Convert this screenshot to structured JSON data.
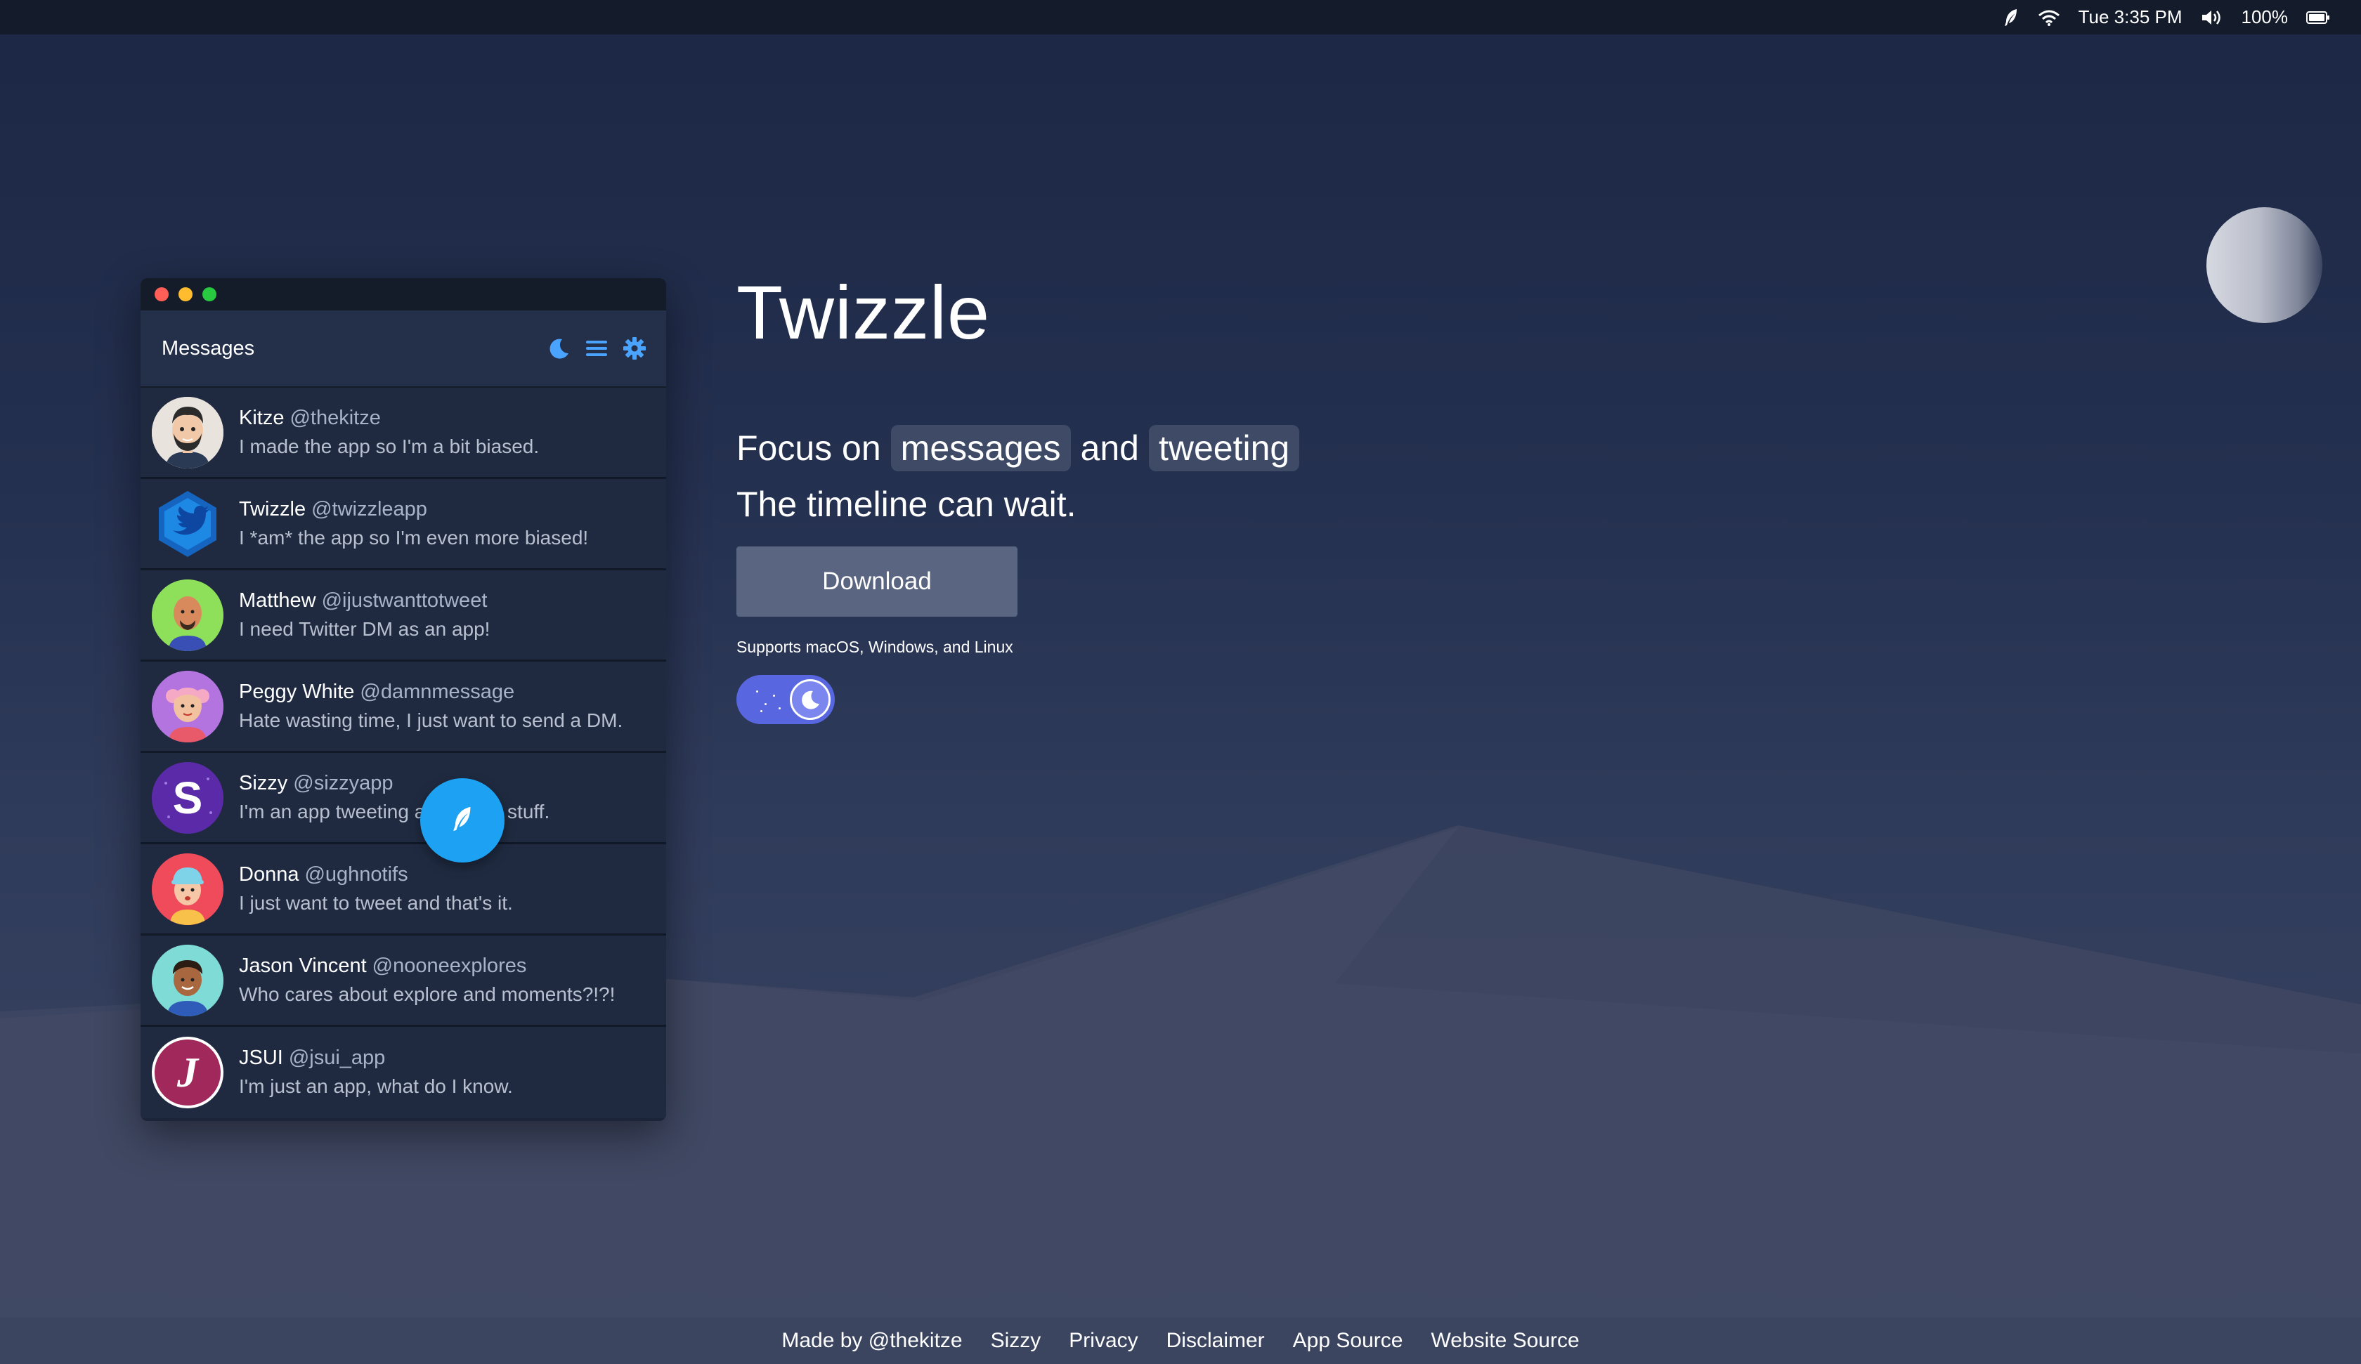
{
  "menubar": {
    "clock": "Tue 3:35 PM",
    "battery": "100%",
    "icons": [
      "feather-icon",
      "wifi-icon",
      "volume-icon",
      "battery-icon"
    ]
  },
  "app": {
    "header_title": "Messages",
    "header_icons": [
      "moon-icon",
      "menu-icon",
      "gear-icon"
    ],
    "accent": "#4aa3ff",
    "messages": [
      {
        "name": "Kitze",
        "handle": "@thekitze",
        "text": "I made the app so I'm a bit biased."
      },
      {
        "name": "Twizzle",
        "handle": "@twizzleapp",
        "text": "I *am* the app so I'm even more biased!"
      },
      {
        "name": "Matthew",
        "handle": "@ijustwanttotweet",
        "text": "I need Twitter DM as an app!"
      },
      {
        "name": "Peggy White",
        "handle": "@damnmessage",
        "text": "Hate wasting time, I just want to send a DM."
      },
      {
        "name": "Sizzy",
        "handle": "@sizzyapp",
        "text": "I'm an app tweeting about app stuff."
      },
      {
        "name": "Donna",
        "handle": "@ughnotifs",
        "text": "I just want to tweet and that's it."
      },
      {
        "name": "Jason Vincent",
        "handle": "@nooneexplores",
        "text": "Who cares about explore and moments?!?!"
      },
      {
        "name": "JSUI",
        "handle": "@jsui_app",
        "text": "I'm just an app, what do I know."
      }
    ],
    "avatar_letters": {
      "sizzy": "S",
      "jsui": "J"
    }
  },
  "hero": {
    "title": "Twizzle",
    "tagline_prefix": "Focus on",
    "tagline_word1": "messages",
    "tagline_and": "and",
    "tagline_word2": "tweeting",
    "tagline2": "The timeline can wait.",
    "download_label": "Download",
    "supports": "Supports macOS, Windows, and Linux",
    "dark_mode_toggle": "on"
  },
  "footer": {
    "links": [
      "Made by @thekitze",
      "Sizzy",
      "Privacy",
      "Disclaimer",
      "App Source",
      "Website Source"
    ]
  },
  "colors": {
    "fab": "#1da1f2",
    "toggle": "#5866e0",
    "download_button": "#5a6581"
  }
}
